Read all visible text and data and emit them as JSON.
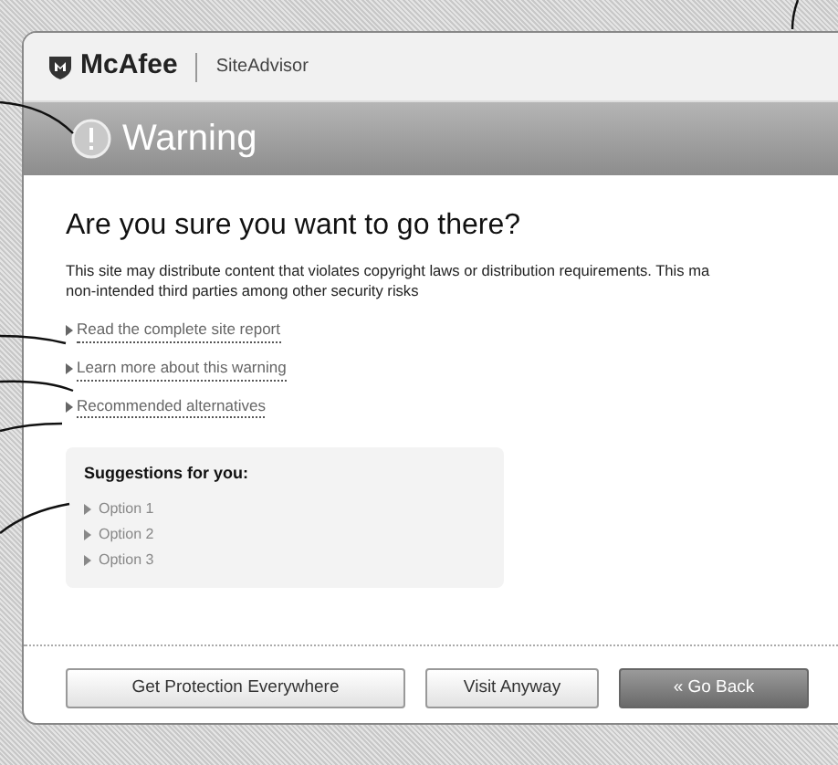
{
  "header": {
    "brand": "McAfee",
    "product": "SiteAdvisor"
  },
  "banner": {
    "title": "Warning"
  },
  "heading": "Are you sure you want to go there?",
  "message": [
    "This site may distribute content that violates copyright laws or distribution requirements. This ma",
    "non-intended third parties among other security risks"
  ],
  "links": [
    "Read the complete site report",
    "Learn more about this warning",
    "Recommended alternatives"
  ],
  "suggestions": {
    "title": "Suggestions for you:",
    "items": [
      "Option 1",
      "Option 2",
      "Option 3"
    ]
  },
  "buttons": [
    {
      "label": "Get Protection Everywhere",
      "kind": "secondary"
    },
    {
      "label": "Visit Anyway",
      "kind": "secondary"
    },
    {
      "label": "« Go Back",
      "kind": "primary"
    }
  ]
}
